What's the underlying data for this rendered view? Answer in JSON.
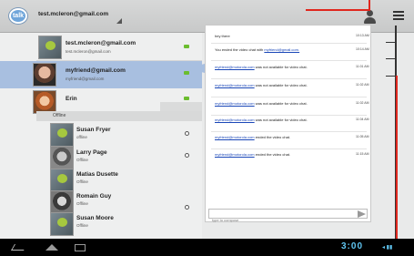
{
  "header": {
    "logo_text": "talk",
    "account_email": "test.mcleron@gmail.com"
  },
  "contacts": {
    "online": [
      {
        "name": "test.mcleron@gmail.com",
        "status": "test.mcleron@gmail.com",
        "presence": "available"
      },
      {
        "name": "myfriend@gmail.com",
        "status": "myfriend@gmail.com",
        "presence": "available",
        "selected": true
      },
      {
        "name": "Erin",
        "status": "",
        "presence": "available"
      }
    ],
    "offline_header": "Offline",
    "offline": [
      {
        "name": "Susan Fryer",
        "status": "offline"
      },
      {
        "name": "Larry Page",
        "status": "Offline"
      },
      {
        "name": "Matias Dusette",
        "status": "Offline"
      },
      {
        "name": "Romain Guy",
        "status": "Offline"
      },
      {
        "name": "Susan Moore",
        "status": "Offline"
      }
    ]
  },
  "chat": {
    "messages": [
      {
        "text": "hey there",
        "time": "10:13 AM"
      },
      {
        "text": "You ended the video chat with",
        "link": "myfriend@gmail.com.",
        "time": "10:14 AM"
      },
      {
        "link": "myfriend@motorola.com",
        "text": "was not available for video chat.",
        "time": "11:01 AM"
      },
      {
        "link": "myfriend@motorola.com",
        "text": "was not available for video chat.",
        "time": "11:02 AM"
      },
      {
        "link": "myfriend@motorola.com",
        "text": "was not available for video chat.",
        "time": "11:02 AM"
      },
      {
        "link": "myfriend@motorola.com",
        "text": "was not available for video chat.",
        "time": "11:04 AM"
      },
      {
        "link": "myfriend@motorola.com",
        "text": "ended the video chat.",
        "time": "11:05 AM"
      },
      {
        "link": "myfriend@motorola.com",
        "text": "ended the video chat.",
        "time": "11:15 AM"
      }
    ],
    "compose_placeholder": "type to compose"
  },
  "system_bar": {
    "clock": "3:00"
  },
  "colors": {
    "accent": "#a8bfe0",
    "online": "#6bbd2f",
    "clock": "#5fc4f0",
    "callout": "#e0271e"
  }
}
